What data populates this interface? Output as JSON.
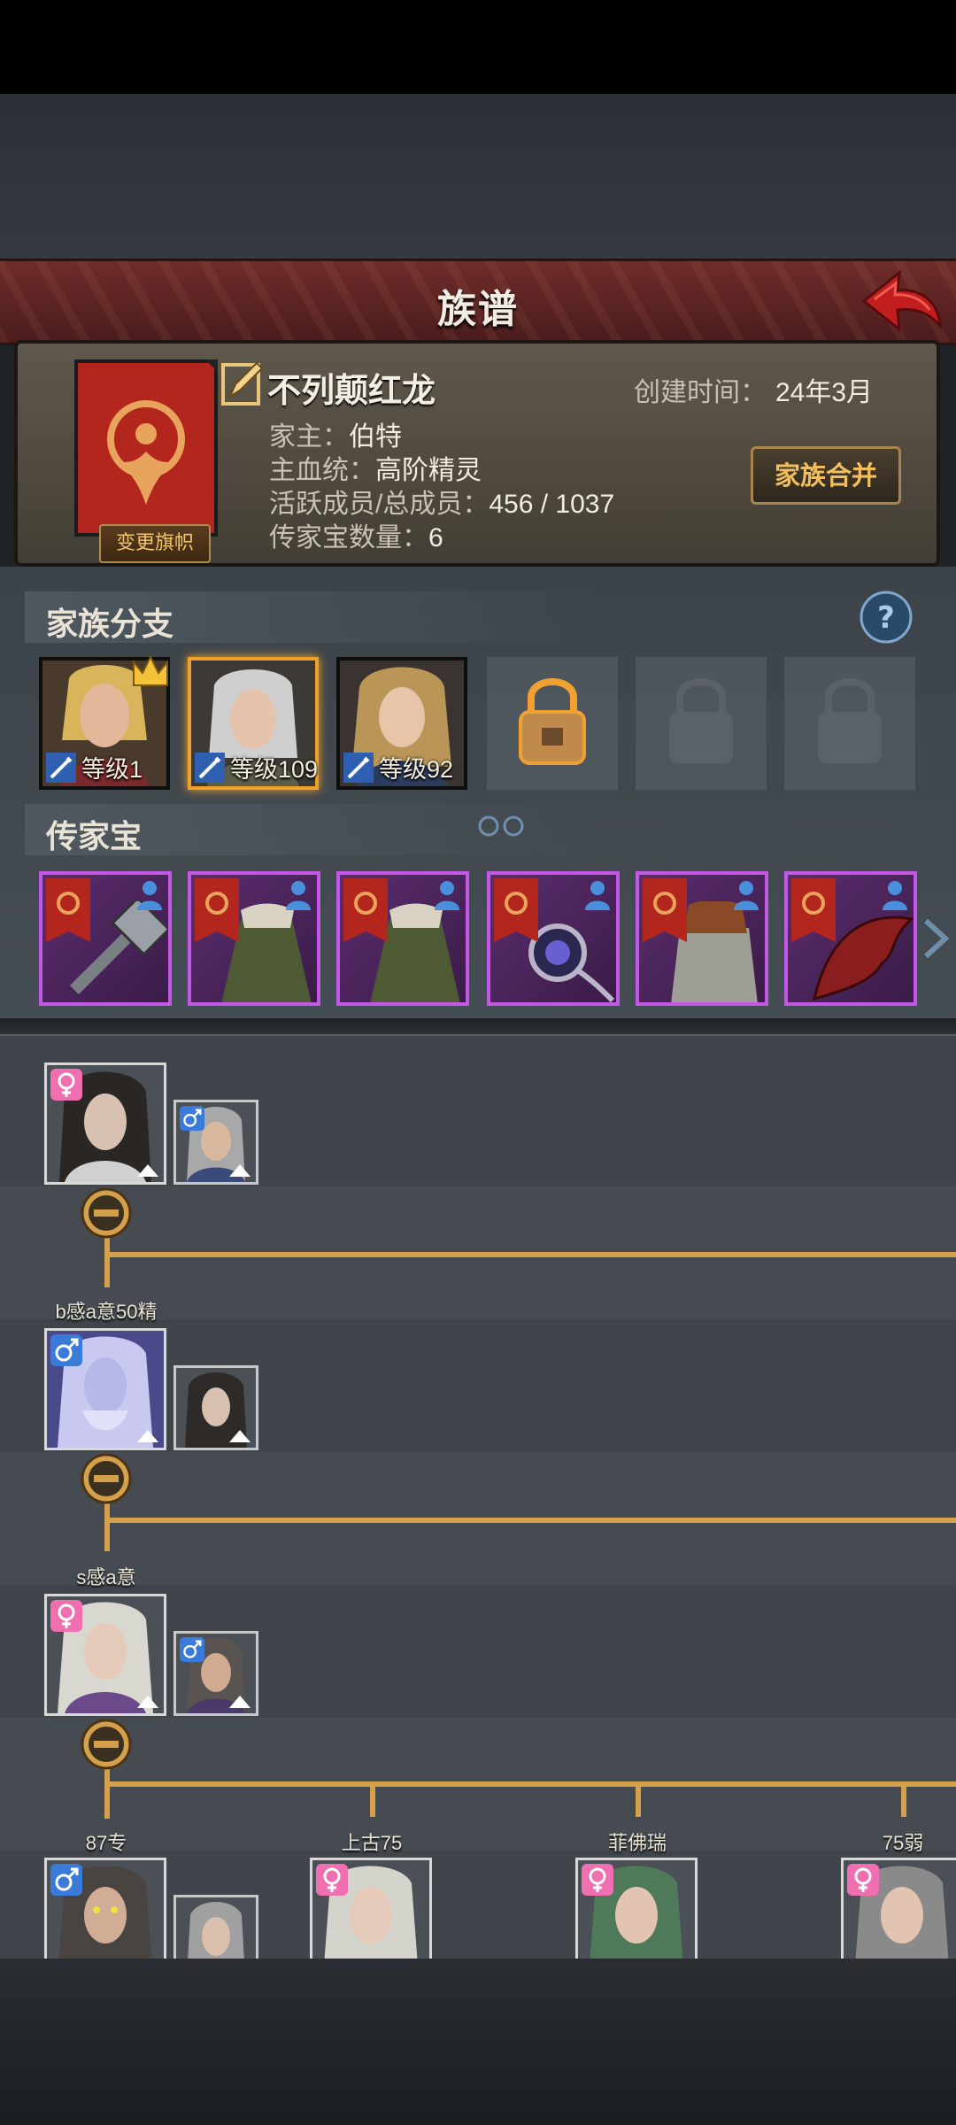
{
  "header": {
    "title": "族谱"
  },
  "family": {
    "name": "不列颠红龙",
    "change_flag_label": "变更旗帜",
    "created_label": "创建时间：",
    "created_value": "24年3月",
    "patriarch_label": "家主：",
    "patriarch_value": "伯特",
    "bloodline_label": "主血统：",
    "bloodline_value": "高阶精灵",
    "members_label": "活跃成员/总成员：",
    "members_value": "456 / 1037",
    "heirloom_count_label": "传家宝数量：",
    "heirloom_count_value": "6",
    "merge_button": "家族合并"
  },
  "branches": {
    "title": "家族分支",
    "slots": [
      {
        "level": "等级1",
        "state": "filled",
        "leader": true
      },
      {
        "level": "等级109",
        "state": "selected",
        "leader": false
      },
      {
        "level": "等级92",
        "state": "filled",
        "leader": false
      },
      {
        "state": "unlockable"
      },
      {
        "state": "locked"
      },
      {
        "state": "locked"
      }
    ]
  },
  "heirlooms": {
    "title": "传家宝",
    "items": [
      "hammer-icon",
      "green-cloak-icon",
      "green-cloak-icon",
      "amulet-icon",
      "chainmail-armor-icon",
      "dragon-wing-icon"
    ]
  },
  "tree": {
    "generations": [
      {
        "name": "",
        "gender": "female",
        "spouse_gender": "male"
      },
      {
        "name": "b感a意50精",
        "gender": "male",
        "spouse_gender": "female"
      },
      {
        "name": "s感a意",
        "gender": "female",
        "spouse_gender": "male"
      }
    ],
    "children": [
      {
        "name": "87专",
        "gender": "male",
        "has_spouse": true
      },
      {
        "name": "上古75",
        "gender": "female",
        "has_spouse": false
      },
      {
        "name": "菲佛瑞",
        "gender": "female",
        "has_spouse": false
      },
      {
        "name": "75弱",
        "gender": "female",
        "has_spouse": false
      }
    ]
  },
  "colors": {
    "accent_gold": "#d4a04c",
    "banner_red": "#6e2c2a",
    "heirloom_purple": "#c457e6",
    "selected_orange": "#f0a12a"
  }
}
